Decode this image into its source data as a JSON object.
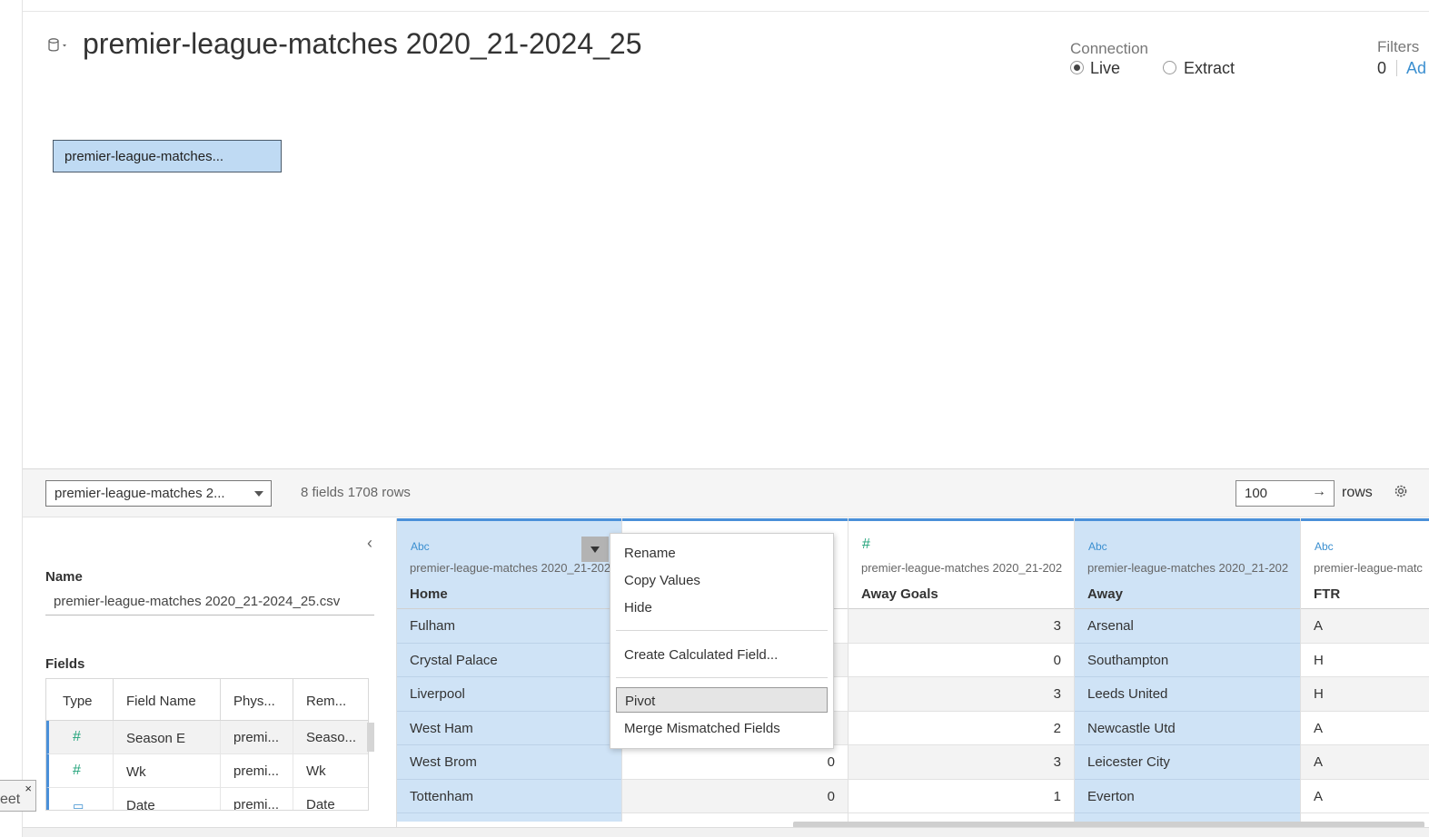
{
  "datasource": {
    "title": "premier-league-matches 2020_21-2024_25",
    "icon": "database-icon"
  },
  "connection": {
    "label": "Connection",
    "live_label": "Live",
    "extract_label": "Extract",
    "selected": "Live"
  },
  "filters": {
    "label": "Filters",
    "count": "0",
    "add_label": "Ad"
  },
  "canvas": {
    "table_chip": "premier-league-matches..."
  },
  "toolbar": {
    "table_select": "premier-league-matches 2...",
    "meta": "8 fields 1708 rows",
    "rows_value": "100",
    "rows_label": "rows",
    "arrow": "→"
  },
  "metadata": {
    "collapse": "‹",
    "name_label": "Name",
    "name_value": "premier-league-matches 2020_21-2024_25.csv",
    "fields_label": "Fields",
    "headers": [
      "Type",
      "Field Name",
      "Phys...",
      "Rem..."
    ],
    "rows": [
      {
        "type": "#",
        "field": "Season E",
        "phys": "premi...",
        "rem": "Seaso..."
      },
      {
        "type": "#",
        "field": "Wk",
        "phys": "premi...",
        "rem": "Wk"
      },
      {
        "type": "▭",
        "field": "Date",
        "phys": "premi...",
        "rem": "Date"
      }
    ]
  },
  "sheet_tab": {
    "label": "eet",
    "close": "×"
  },
  "grid": {
    "columns": [
      {
        "type": "Abc",
        "source": "premier-league-matches 2020_21-202",
        "name": "Home",
        "values": [
          "Fulham",
          "Crystal Palace",
          "Liverpool",
          "West Ham",
          "West Brom",
          "Tottenham"
        ]
      },
      {
        "type": "#",
        "source": "",
        "name": "",
        "values": [
          "",
          "",
          "",
          "",
          "0",
          "0"
        ]
      },
      {
        "type": "#",
        "source": "premier-league-matches 2020_21-202",
        "name": "Away Goals",
        "values": [
          "3",
          "0",
          "3",
          "2",
          "3",
          "1"
        ]
      },
      {
        "type": "Abc",
        "source": "premier-league-matches 2020_21-202",
        "name": "Away",
        "values": [
          "Arsenal",
          "Southampton",
          "Leeds United",
          "Newcastle Utd",
          "Leicester City",
          "Everton"
        ]
      },
      {
        "type": "Abc",
        "source": "premier-league-matc",
        "name": "FTR",
        "values": [
          "A",
          "H",
          "H",
          "A",
          "A",
          "A"
        ]
      }
    ]
  },
  "context_menu": {
    "items": [
      "Rename",
      "Copy Values",
      "Hide",
      "Create Calculated Field...",
      "Pivot",
      "Merge Mismatched Fields"
    ],
    "highlighted": "Pivot"
  },
  "colors": {
    "accent": "#4a90d9",
    "selected_column": "#cfe3f6",
    "chip": "#bfdaf3"
  }
}
